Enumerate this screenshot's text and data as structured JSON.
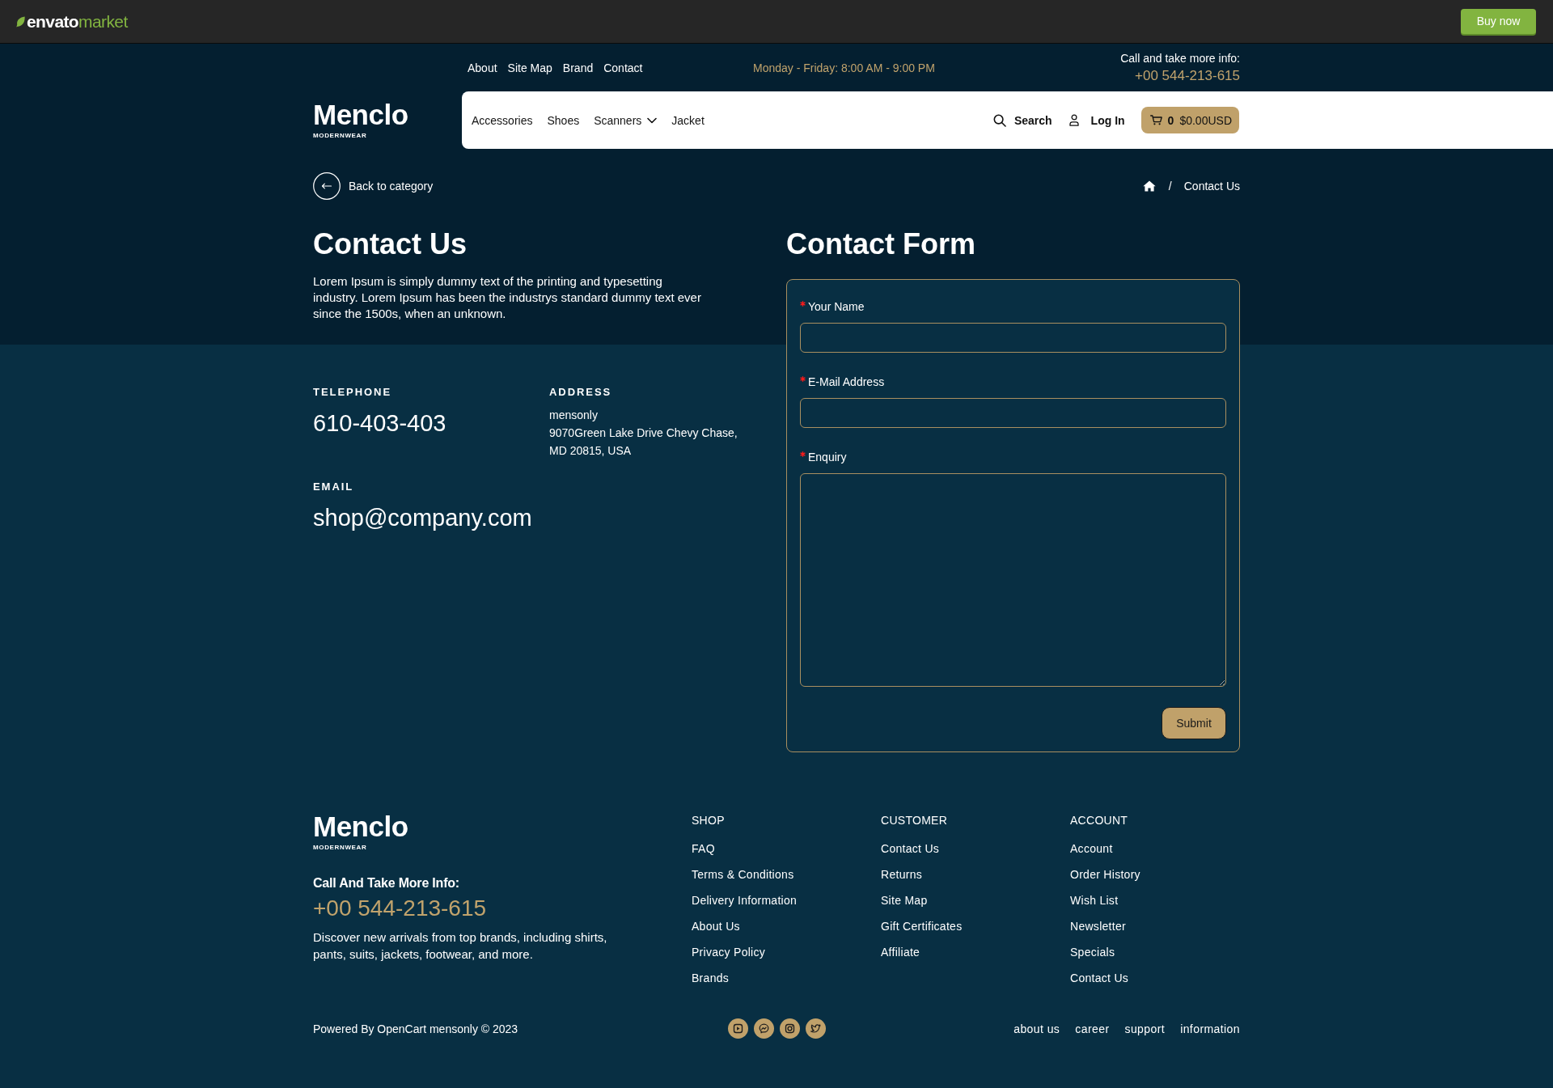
{
  "envato_bar": {
    "logo_primary": "envato",
    "logo_secondary": "market",
    "buy_button": "Buy now"
  },
  "header": {
    "top_links": [
      {
        "label": "About"
      },
      {
        "label": "Site Map"
      },
      {
        "label": "Brand"
      },
      {
        "label": "Contact"
      }
    ],
    "hours": "Monday - Friday: 8:00 AM - 9:00 PM",
    "call_label": "Call and take more info:",
    "call_phone": "+00 544-213-615",
    "logo": {
      "name": "Menclo",
      "tagline": "MODERNWEAR"
    },
    "nav": [
      {
        "label": "Accessories",
        "dropdown": false
      },
      {
        "label": "Shoes",
        "dropdown": false
      },
      {
        "label": "Scanners",
        "dropdown": true
      },
      {
        "label": "Jacket",
        "dropdown": false
      }
    ],
    "search_label": "Search",
    "login_label": "Log In",
    "cart": {
      "count": "0",
      "total": "$0.00USD"
    }
  },
  "back_link": "Back to category",
  "breadcrumb": {
    "separator": "/",
    "current": "Contact Us"
  },
  "intro": {
    "title": "Contact Us",
    "text": "Lorem Ipsum is simply dummy text of the printing and typesetting industry. Lorem Ipsum has been the industrys standard dummy text ever since the 1500s, when an unknown."
  },
  "details": [
    {
      "kind": "value",
      "label": "TELEPHONE",
      "value": "610-403-403"
    },
    {
      "kind": "lines",
      "label": "ADDRESS",
      "lines": [
        "mensonly",
        "9070Green Lake Drive Chevy Chase,",
        "MD 20815, USA"
      ]
    },
    {
      "kind": "value",
      "label": "EMAIL",
      "value": "shop@company.com"
    }
  ],
  "contact_form": {
    "title": "Contact Form",
    "fields": [
      {
        "kind": "input",
        "label": "Your Name",
        "required": true
      },
      {
        "kind": "input",
        "label": "E-Mail Address",
        "required": true
      },
      {
        "kind": "textarea",
        "label": "Enquiry",
        "required": true
      }
    ],
    "submit": "Submit"
  },
  "footer": {
    "logo": {
      "name": "Menclo",
      "tagline": "MODERNWEAR"
    },
    "call_label": "Call And Take More Info:",
    "phone": "+00 544-213-615",
    "text": "Discover new arrivals from top brands, including shirts, pants, suits, jackets, footwear, and more.",
    "columns": [
      {
        "title": "SHOP",
        "links": [
          "FAQ",
          "Terms & Conditions",
          "Delivery Information",
          "About Us",
          "Privacy Policy",
          "Brands"
        ]
      },
      {
        "title": "CUSTOMER",
        "links": [
          "Contact Us",
          "Returns",
          "Site Map",
          "Gift Certificates",
          "Affiliate"
        ]
      },
      {
        "title": "ACCOUNT",
        "links": [
          "Account",
          "Order History",
          "Wish List",
          "Newsletter",
          "Specials",
          "Contact Us"
        ]
      }
    ],
    "copyright": "Powered By OpenCart mensonly © 2023",
    "bottom_links": [
      "about us",
      "career",
      "support",
      "information"
    ]
  }
}
